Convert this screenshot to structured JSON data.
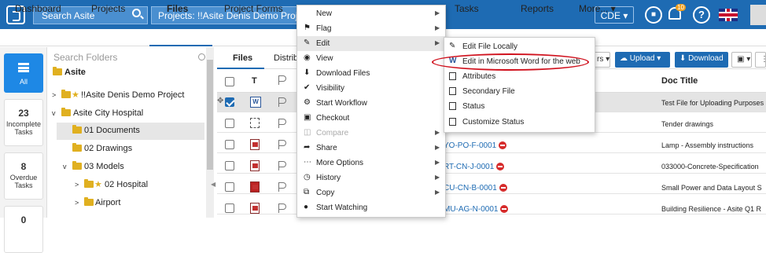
{
  "topbar": {
    "search_placeholder": "Search Asite",
    "project_selector": "Projects: !!Asite Denis Demo Project, A",
    "cde_label": "CDE",
    "notification_count": "10",
    "help_label": "?"
  },
  "nav": {
    "tabs": [
      "Dashboard",
      "Projects",
      "Files",
      "Project Forms",
      "Tasks",
      "Reports",
      "More..."
    ],
    "active": "Files"
  },
  "left_rail": {
    "all_label": "All",
    "incomplete_count": "23",
    "incomplete_label": "Incomplete Tasks",
    "overdue_count": "8",
    "overdue_label": "Overdue Tasks",
    "next_count": "0"
  },
  "folders": {
    "search_placeholder": "Search Folders",
    "items": [
      {
        "label": "Asite",
        "bold": true
      },
      {
        "label": "!!Asite Denis Demo Project",
        "starred": true
      },
      {
        "label": "Asite City Hospital"
      },
      {
        "label": "01 Documents"
      },
      {
        "label": "02 Drawings"
      },
      {
        "label": "03 Models"
      },
      {
        "label": "02 Hospital",
        "starred": true
      },
      {
        "label": "Airport"
      }
    ]
  },
  "file_tabs": [
    "Files",
    "Distribu"
  ],
  "toolbar": {
    "upload_label": "Upload",
    "download_label": "Download",
    "partial_label": "rs"
  },
  "table": {
    "col_type": "T",
    "col_title": "Doc Title",
    "rows": [
      {
        "doc_ref": "",
        "title": "Test File for Uploading Purposes"
      },
      {
        "doc_ref": "",
        "title": "Tender drawings"
      },
      {
        "doc_ref": "YO-PO-F-0001",
        "title": "Lamp - Assembly instructions"
      },
      {
        "doc_ref": "RT-CN-J-0001",
        "title": "033000-Concrete-Specification"
      },
      {
        "doc_ref": "CU-CN-B-0001",
        "title": "Small Power and Data Layout S"
      },
      {
        "doc_ref": "MU-AG-N-0001",
        "title": "Building Resilience - Asite Q1 R"
      }
    ]
  },
  "context_menu": {
    "items": [
      {
        "label": "New",
        "icon": "",
        "submenu": true
      },
      {
        "label": "Flag",
        "icon": "flag-icon",
        "submenu": true
      },
      {
        "label": "Edit",
        "icon": "pencil-icon",
        "submenu": true,
        "highlighted": true
      },
      {
        "label": "View",
        "icon": "eye-icon"
      },
      {
        "label": "Download Files",
        "icon": "download-icon"
      },
      {
        "label": "Visibility",
        "icon": "check-icon"
      },
      {
        "label": "Start Workflow",
        "icon": "workflow-icon"
      },
      {
        "label": "Checkout",
        "icon": "checkout-icon"
      },
      {
        "label": "Compare",
        "icon": "compare-icon",
        "submenu": true,
        "disabled": true
      },
      {
        "label": "Share",
        "icon": "share-icon",
        "submenu": true
      },
      {
        "label": "More Options",
        "icon": "ellipsis-icon",
        "submenu": true
      },
      {
        "label": "History",
        "icon": "history-icon",
        "submenu": true
      },
      {
        "label": "Copy",
        "icon": "copy-icon",
        "submenu": true
      },
      {
        "label": "Start Watching",
        "icon": "watch-icon"
      }
    ]
  },
  "edit_submenu": {
    "items": [
      {
        "label": "Edit File Locally",
        "icon": "pencil-icon"
      },
      {
        "label": "Edit in Microsoft Word for the web",
        "icon": "word-icon"
      },
      {
        "label": "Attributes",
        "icon": "attributes-icon"
      },
      {
        "label": "Secondary File",
        "icon": "file-icon"
      },
      {
        "label": "Status",
        "icon": "status-icon"
      },
      {
        "label": "Customize Status",
        "icon": "customize-status-icon"
      }
    ]
  },
  "colors": {
    "brand": "#1e6bb3",
    "highlight_oval": "#d0121e"
  }
}
